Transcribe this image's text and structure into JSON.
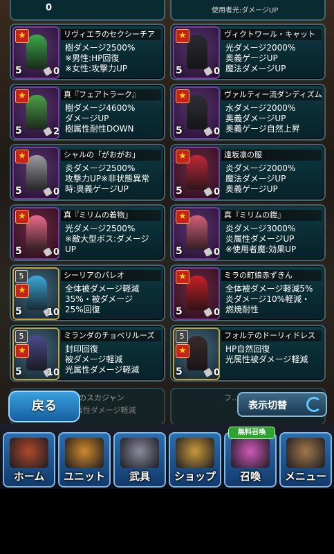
{
  "items": [
    {
      "name": "リヴィエラのセクシーチア",
      "effects": [
        "樹ダメージ2500%",
        "※男性:HP回復",
        "※女性:攻撃力UP"
      ],
      "level": "5",
      "count": "0",
      "col": 0,
      "row": 0,
      "variant": "purple",
      "figColor": "#3aa84a"
    },
    {
      "name": "ヴィクトワール・キャット",
      "effects": [
        "光ダメージ2000%",
        "奥義ゲージUP",
        "魔法ダメージUP"
      ],
      "level": "5",
      "count": "0",
      "col": 1,
      "row": 0,
      "variant": "purple",
      "figColor": "#2b2b33"
    },
    {
      "name": "真『フェアトラーク』",
      "effects": [
        "樹ダメージ4600%",
        "ダメージUP",
        "樹属性耐性DOWN"
      ],
      "level": "5",
      "count": "2",
      "col": 0,
      "row": 1,
      "variant": "purple",
      "figColor": "#4aa048"
    },
    {
      "name": "ヴァルティー流ダンディズム",
      "effects": [
        "水ダメージ2000%",
        "奥義ダメージUP",
        "奥義ゲージ自然上昇"
      ],
      "level": "5",
      "count": "0",
      "col": 1,
      "row": 1,
      "variant": "purple",
      "figColor": "#2e2e36"
    },
    {
      "name": "シャルの「がおがお」",
      "effects": [
        "炎ダメージ2500%",
        "攻撃力UP※非状態異常",
        "時:奥義ゲージUP"
      ],
      "level": "5",
      "count": "0",
      "col": 0,
      "row": 2,
      "variant": "purple",
      "figColor": "#9a9aa0"
    },
    {
      "name": "遠坂凛の服",
      "effects": [
        "炎ダメージ2000%",
        "魔法ダメージUP",
        "奥義ゲージUP"
      ],
      "level": "5",
      "count": "0",
      "col": 1,
      "row": 2,
      "variant": "pink",
      "figColor": "#c0283a"
    },
    {
      "name": "真『ミリムの着物』",
      "effects": [
        "光ダメージ2500%",
        "※敵大型ボス:ダメージ",
        "UP"
      ],
      "level": "5",
      "count": "0",
      "col": 0,
      "row": 3,
      "variant": "pink",
      "figColor": "#e86a8a"
    },
    {
      "name": "真『ミリムの鎧』",
      "effects": [
        "炎ダメージ3000%",
        "炎属性ダメージUP",
        "※使用者魔:効果UP"
      ],
      "level": "5",
      "count": "0",
      "col": 1,
      "row": 3,
      "variant": "purple",
      "figColor": "#d0607a"
    },
    {
      "name": "シーリアのパレオ",
      "effects": [
        "全体被ダメージ軽減",
        "35%・被ダメージ",
        "25%回復"
      ],
      "level": "5",
      "count": "10",
      "col": 0,
      "row": 4,
      "variant": "gold",
      "figColor": "#3aa8d8"
    },
    {
      "name": "ミラの町娘赤ずきん",
      "effects": [
        "全体被ダメージ軽減5%",
        "炎ダメージ10%軽減・",
        "燃焼耐性"
      ],
      "level": "5",
      "count": "0",
      "col": 1,
      "row": 4,
      "variant": "pink",
      "figColor": "#c81f2a"
    },
    {
      "name": "ミランダのチョベリルーズ",
      "effects": [
        "封印回復",
        "被ダメージ軽減",
        "光属性ダメージ軽減"
      ],
      "level": "5",
      "count": "10",
      "col": 0,
      "row": 5,
      "variant": "gold",
      "figColor": "#4a4a8a"
    },
    {
      "name": "フォルテのドーリィドレス",
      "effects": [
        "HP自然回復",
        "光属性被ダメージ軽減"
      ],
      "level": "5",
      "count": "0",
      "col": 1,
      "row": 5,
      "variant": "gold",
      "figColor": "#3a2a2a"
    }
  ],
  "partial_top": {
    "left_count": "0",
    "right_text": "使用者光:ダメージUP"
  },
  "partial_bottom": {
    "left_title": "流子のスカジャン",
    "left_desc": "炎属性ダメージ軽減",
    "right_title": "フ…"
  },
  "back_button": "戻る",
  "toggle_button": "表示切替",
  "free_badge": "無料召喚",
  "nav": [
    {
      "label": "ホーム",
      "color": "#b04a2a"
    },
    {
      "label": "ユニット",
      "color": "#d08a2a"
    },
    {
      "label": "武具",
      "color": "#8a8a9a"
    },
    {
      "label": "ショップ",
      "color": "#c89a3a"
    },
    {
      "label": "召喚",
      "color": "#d05ab8"
    },
    {
      "label": "メニュー",
      "color": "#a07848"
    }
  ]
}
